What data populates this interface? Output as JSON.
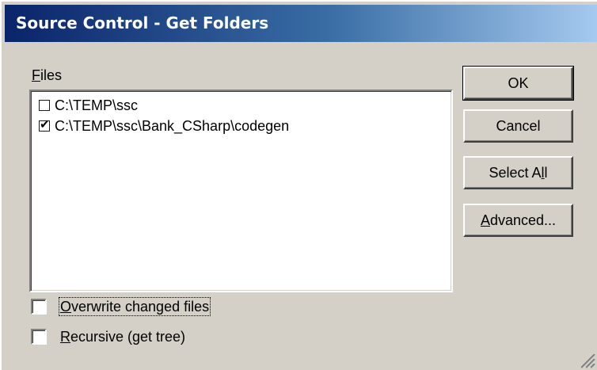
{
  "window": {
    "title": "Source Control - Get Folders"
  },
  "files": {
    "label_prefix": "",
    "label_accel": "F",
    "label_rest": "iles",
    "items": [
      {
        "path": "C:\\TEMP\\ssc",
        "checked": false
      },
      {
        "path": "C:\\TEMP\\ssc\\Bank_CSharp\\codegen",
        "checked": true
      }
    ]
  },
  "options": {
    "overwrite": {
      "accel": "O",
      "rest": "verwrite changed files",
      "checked": false
    },
    "recursive": {
      "accel": "R",
      "rest": "ecursive (get tree)",
      "checked": false
    }
  },
  "buttons": {
    "ok": {
      "label": "OK"
    },
    "cancel": {
      "label": "Cancel"
    },
    "select_all": {
      "pre": "Select A",
      "accel": "l",
      "post": "l"
    },
    "advanced": {
      "pre": "",
      "accel": "A",
      "post": "dvanced..."
    }
  },
  "icons": {
    "checkmark": "✔",
    "size_grip": "size-grip-icon"
  }
}
